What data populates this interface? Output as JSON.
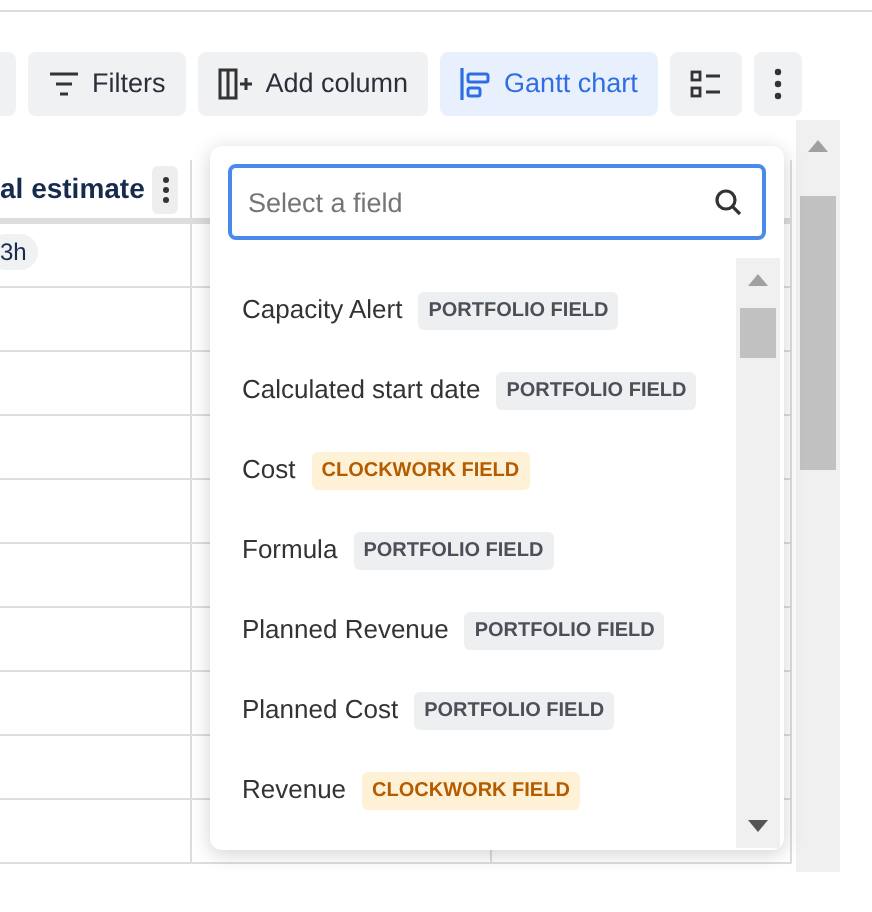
{
  "toolbar": [
    {
      "kind": "partial"
    },
    {
      "kind": "filters",
      "label": "Filters"
    },
    {
      "kind": "add-column",
      "label": "Add column"
    },
    {
      "kind": "gantt",
      "label": "Gantt chart",
      "selected": true
    },
    {
      "kind": "list"
    },
    {
      "kind": "more"
    }
  ],
  "table": {
    "columns": [
      {
        "label": "al estimate"
      }
    ],
    "first_cell": "3h"
  },
  "field_picker": {
    "search": {
      "placeholder": "Select a field"
    },
    "items": [
      {
        "name": "Capacity Alert",
        "tag": "PORTFOLIO FIELD",
        "kind": "portfolio"
      },
      {
        "name": "Calculated start date",
        "tag": "PORTFOLIO FIELD",
        "kind": "portfolio"
      },
      {
        "name": "Cost",
        "tag": "CLOCKWORK FIELD",
        "kind": "clockwork"
      },
      {
        "name": "Formula",
        "tag": "PORTFOLIO FIELD",
        "kind": "portfolio"
      },
      {
        "name": "Planned Revenue",
        "tag": "PORTFOLIO FIELD",
        "kind": "portfolio"
      },
      {
        "name": "Planned Cost",
        "tag": "PORTFOLIO FIELD",
        "kind": "portfolio"
      },
      {
        "name": "Revenue",
        "tag": "CLOCKWORK FIELD",
        "kind": "clockwork"
      }
    ]
  }
}
